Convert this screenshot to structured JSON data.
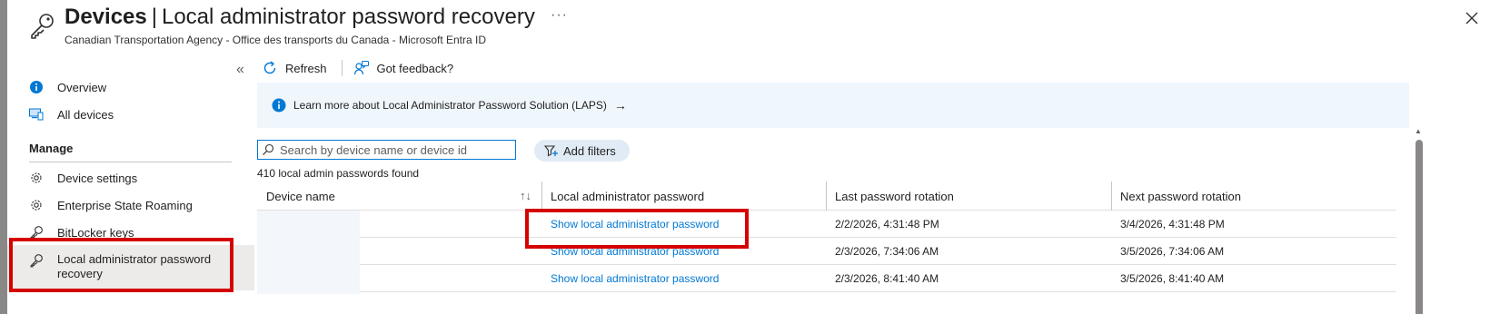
{
  "header": {
    "title_bold": "Devices",
    "title_sep": "|",
    "title_rest": "Local administrator password recovery",
    "more": "···",
    "subtitle": "Canadian Transportation Agency - Office des transports du Canada - Microsoft Entra ID"
  },
  "sidebar": {
    "collapse": "«",
    "items_top": [
      {
        "label": "Overview",
        "icon": "info-icon"
      },
      {
        "label": "All devices",
        "icon": "devices-icon"
      }
    ],
    "section_label": "Manage",
    "items_manage": [
      {
        "label": "Device settings",
        "icon": "gear-icon"
      },
      {
        "label": "Enterprise State Roaming",
        "icon": "gear-icon"
      },
      {
        "label": "BitLocker keys",
        "icon": "key-icon"
      },
      {
        "label": "Local administrator password recovery",
        "icon": "key-icon",
        "selected": true
      }
    ]
  },
  "toolbar": {
    "refresh_label": "Refresh",
    "feedback_label": "Got feedback?"
  },
  "info_bar": {
    "link_text": "Learn more about Local Administrator Password Solution (LAPS)",
    "arrow": "→"
  },
  "search": {
    "placeholder": "Search by device name or device id"
  },
  "filters": {
    "add_label": "Add filters"
  },
  "results": {
    "count_text": "410 local admin passwords found"
  },
  "table": {
    "columns": [
      "Device name",
      "Local administrator password",
      "Last password rotation",
      "Next password rotation"
    ],
    "sort_icon": "↑↓",
    "rows": [
      {
        "device": "",
        "password_link": "Show local administrator password",
        "last": "2/2/2026, 4:31:48 PM",
        "next": "3/4/2026, 4:31:48 PM"
      },
      {
        "device": "",
        "password_link": "Show local administrator password",
        "last": "2/3/2026, 7:34:06 AM",
        "next": "3/5/2026, 7:34:06 AM"
      },
      {
        "device": "",
        "password_link": "Show local administrator password",
        "last": "2/3/2026, 8:41:40 AM",
        "next": "3/5/2026, 8:41:40 AM"
      }
    ]
  },
  "colors": {
    "accent": "#0078d4",
    "highlight": "#d50000",
    "info_bg": "#eff6fc",
    "selected_bg": "#edebe9"
  }
}
